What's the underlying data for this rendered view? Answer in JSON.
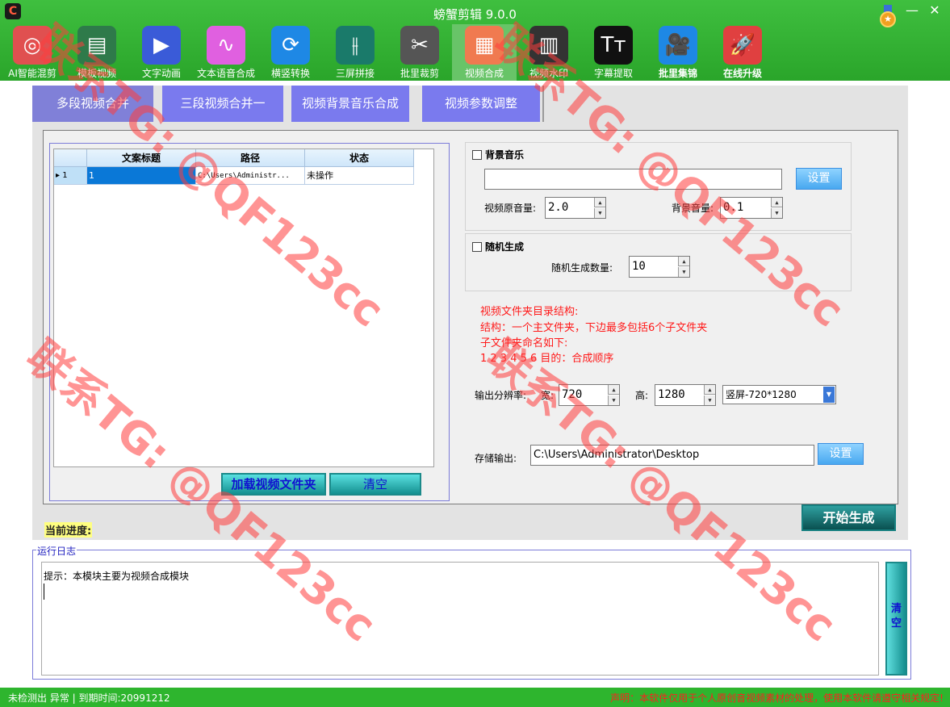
{
  "window": {
    "title": "螃蟹剪辑 9.0.0",
    "minimize": "—",
    "close": "✕"
  },
  "toolbar": [
    {
      "label": "AI智能混剪",
      "icon": "robot-icon",
      "glyph": "◎",
      "color": "#e05050",
      "bold": false
    },
    {
      "label": "模板视频",
      "icon": "template-video-icon",
      "glyph": "▤",
      "color": "#2e7a4a",
      "bold": false
    },
    {
      "label": "文字动画",
      "icon": "text-animation-icon",
      "glyph": "▶",
      "color": "#3a5bd8",
      "bold": false
    },
    {
      "label": "文本语音合成",
      "icon": "text-to-speech-icon",
      "glyph": "∿",
      "color": "#e060e0",
      "bold": false
    },
    {
      "label": "横竖转换",
      "icon": "rotate-icon",
      "glyph": "⟳",
      "color": "#1e88e5",
      "bold": false
    },
    {
      "label": "三屏拼接",
      "icon": "split-screen-icon",
      "glyph": "⫲",
      "color": "#1a7a6a",
      "bold": false
    },
    {
      "label": "批里裁剪",
      "icon": "crop-icon",
      "glyph": "✂",
      "color": "#555555",
      "bold": false
    },
    {
      "label": "视频合成",
      "icon": "video-merge-icon",
      "glyph": "▦",
      "color": "#f07a50",
      "bold": false
    },
    {
      "label": "视频水印",
      "icon": "watermark-icon",
      "glyph": "▥",
      "color": "#333333",
      "bold": false
    },
    {
      "label": "字幕提取",
      "icon": "subtitle-icon",
      "glyph": "Tт",
      "color": "#111111",
      "bold": false
    },
    {
      "label": "批里集锦",
      "icon": "camera-icon",
      "glyph": "🎥",
      "color": "#1e88e5",
      "bold": true
    },
    {
      "label": "在线升级",
      "icon": "rocket-icon",
      "glyph": "🚀",
      "color": "#e04040",
      "bold": true
    }
  ],
  "tabs": [
    "多段视频合并",
    "三段视频合并一",
    "视频背景音乐合成",
    "视频参数调整"
  ],
  "grid": {
    "headers": [
      "文案标题",
      "路径",
      "状态"
    ],
    "row": {
      "index": "▸ 1",
      "title": "1",
      "path": "C:\\Users\\Administr...",
      "status": "未操作"
    }
  },
  "buttons": {
    "load_folder": "加载视频文件夹",
    "clear": "清空",
    "set_music": "设置",
    "set_output": "设置",
    "start": "开始生成",
    "log_clear": "清空"
  },
  "music": {
    "checkbox_label": "背景音乐",
    "path": "",
    "orig_volume_label": "视频原音量:",
    "orig_volume": "2.0",
    "bg_volume_label": "背景音量:",
    "bg_volume": "0.1"
  },
  "random": {
    "checkbox_label": "随机生成",
    "count_label": "随机生成数量:",
    "count": "10"
  },
  "notes": [
    "视频文件夹目录结构:",
    "结构：一个主文件夹，下边最多包括6个子文件夹",
    "子文件夹命名如下:",
    "1 2 3 4 5 6        目的：合成顺序"
  ],
  "resolution": {
    "label": "输出分辨率:",
    "width_label": "宽:",
    "width": "720",
    "height_label": "高:",
    "height": "1280",
    "preset": "竖屏-720*1280"
  },
  "output": {
    "label": "存储输出:",
    "path": "C:\\Users\\Administrator\\Desktop"
  },
  "progress_label": "当前进度:",
  "log": {
    "title": "运行日志",
    "text": "提示：本模块主要为视频合成模块"
  },
  "status": {
    "left": "未检测出 异常 | 到期时间:20991212",
    "right": "声明：本软件仅用于个人原创音视频素材的处理，使用本软件请遵守相关规定!"
  },
  "watermark": {
    "text": "联系TG: @QF123cc"
  }
}
